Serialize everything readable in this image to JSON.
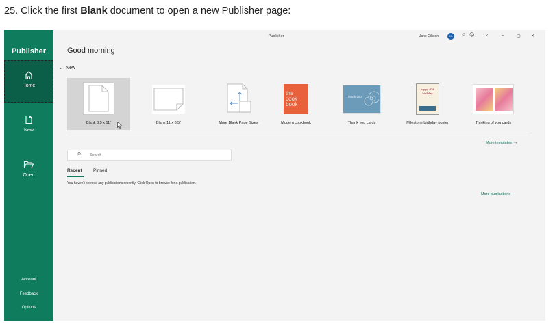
{
  "instruction": {
    "prefix": "25. Click the first ",
    "bold": "Blank",
    "suffix": " document to open a new Publisher page:"
  },
  "titlebar": {
    "title": "Publisher",
    "user_name": "Jane Gibson",
    "avatar_initials": "JG",
    "help": "?",
    "minimize": "–",
    "restore": "▢",
    "close": "✕"
  },
  "sidebar": {
    "app_name": "Publisher",
    "items": [
      {
        "label": "Home"
      },
      {
        "label": "New"
      },
      {
        "label": "Open"
      }
    ],
    "footer": [
      {
        "label": "Account"
      },
      {
        "label": "Feedback"
      },
      {
        "label": "Options"
      }
    ]
  },
  "main": {
    "greeting": "Good morning",
    "new_section": "New",
    "templates": [
      {
        "label": "Blank 8.5 x 11\""
      },
      {
        "label": "Blank 11 x 8.5\""
      },
      {
        "label": "More Blank Page Sizes"
      },
      {
        "label": "Modern cookbook",
        "thumb_text": "the cook book"
      },
      {
        "label": "Thank you cards",
        "thumb_text": "thank you"
      },
      {
        "label": "Milestone birthday poster",
        "thumb_text": "happy 40th birthday"
      },
      {
        "label": "Thinking of you cards"
      }
    ],
    "more_templates": "More templates",
    "search_placeholder": "Search",
    "tabs": [
      {
        "label": "Recent"
      },
      {
        "label": "Pinned"
      }
    ],
    "empty_message": "You haven't opened any publications recently. Click Open to browse for a publication.",
    "more_publications": "More publications"
  },
  "colors": {
    "accent": "#107c5e",
    "accent_dark": "#0b5e47",
    "background": "#f3f3f3"
  }
}
